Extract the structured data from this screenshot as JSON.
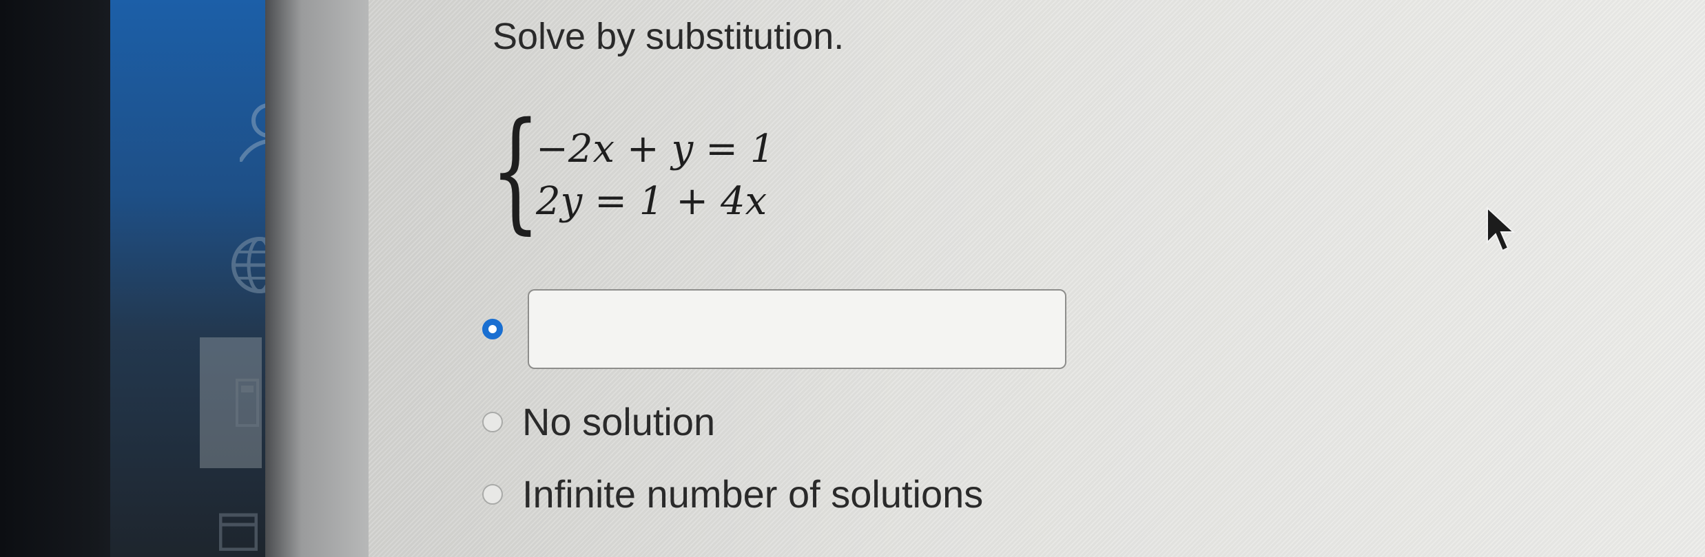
{
  "question": {
    "instruction": "Solve by substitution.",
    "equations": [
      "−2x + y = 1",
      "2y = 1 + 4x"
    ]
  },
  "options": [
    {
      "type": "input",
      "selected": true,
      "value": ""
    },
    {
      "type": "choice",
      "selected": false,
      "label": "No solution"
    },
    {
      "type": "choice",
      "selected": false,
      "label": "Infinite number of solutions"
    }
  ],
  "icons": {
    "sidebar": [
      "user-icon",
      "globe-icon",
      "calculator-icon",
      "calendar-icon"
    ],
    "pointer": "cursor-arrow-icon"
  },
  "colors": {
    "accent": "#1a6fd1",
    "sidebar_blue": "#1e4f86",
    "text": "#2a2a2a"
  }
}
